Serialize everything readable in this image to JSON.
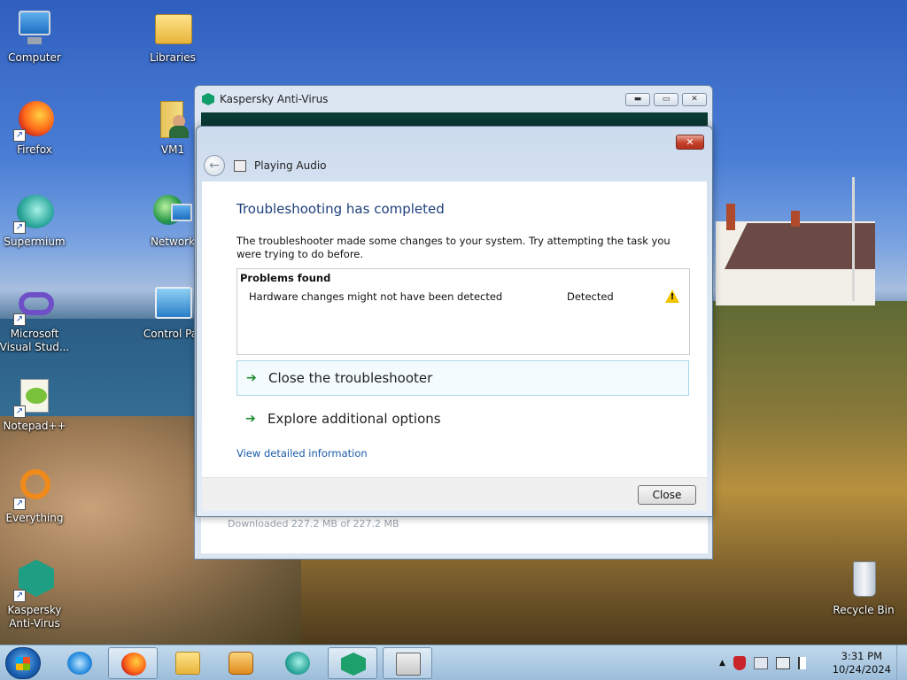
{
  "desktop": {
    "icons": [
      {
        "label": "Computer"
      },
      {
        "label": "Libraries"
      },
      {
        "label": "Firefox"
      },
      {
        "label": "VM1"
      },
      {
        "label": "Supermium"
      },
      {
        "label": "Network"
      },
      {
        "label": "Microsoft Visual Stud..."
      },
      {
        "label": "Control Par"
      },
      {
        "label": "Notepad++"
      },
      {
        "label": "Everything"
      },
      {
        "label": "Kaspersky Anti-Virus"
      },
      {
        "label": "Recycle Bin"
      }
    ]
  },
  "kaspersky_window": {
    "title": "Kaspersky Anti-Virus",
    "status": "Downloaded 227.2 MB of 227.2 MB"
  },
  "troubleshooter": {
    "nav_title": "Playing Audio",
    "close_glyph": "✕",
    "heading": "Troubleshooting has completed",
    "description": "The troubleshooter made some changes to your system. Try attempting the task you were trying to do before.",
    "problems_header": "Problems found",
    "problems": [
      {
        "name": "Hardware changes might not have been detected",
        "status": "Detected"
      }
    ],
    "commands": [
      {
        "label": "Close the troubleshooter"
      },
      {
        "label": "Explore additional options"
      }
    ],
    "detail_link": "View detailed information",
    "close_button": "Close"
  },
  "taskbar": {
    "clock_time": "3:31 PM",
    "clock_date": "10/24/2024",
    "tray_arrow": "▲"
  }
}
